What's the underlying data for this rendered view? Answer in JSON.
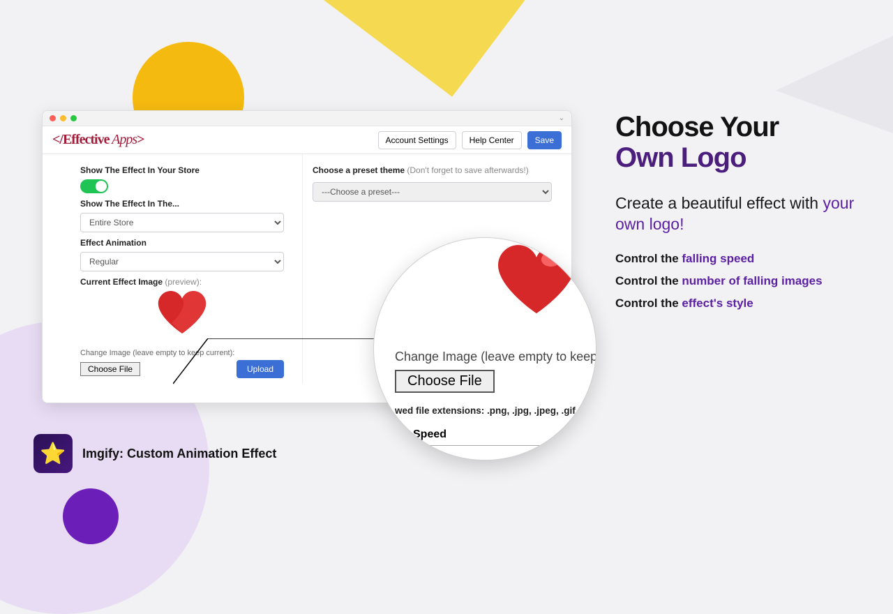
{
  "toolbar": {
    "account": "Account Settings",
    "help": "Help Center",
    "save": "Save"
  },
  "left": {
    "show_store_label": "Show The Effect In Your Store",
    "show_in_label": "Show The Effect In The...",
    "show_in_value": "Entire Store",
    "anim_label": "Effect Animation",
    "anim_value": "Regular",
    "current_label": "Current Effect Image",
    "current_sub": "(preview):",
    "change_label": "Change Image (leave empty to keep current):",
    "choose_file": "Choose File",
    "upload": "Upload"
  },
  "right": {
    "preset_label": "Choose a preset theme",
    "preset_sub": "(Don't forget to save afterwards!)",
    "preset_value": "---Choose a preset---"
  },
  "zoom": {
    "change_label": "Change Image (leave empty to keep current)",
    "choose_file": "Choose File",
    "ext": "wed file extensions: .png, .jpg, .jpeg, .gif, .bmp;",
    "speed": "Speed"
  },
  "mkt": {
    "h1a": "Choose Your",
    "h1b": "Own Logo",
    "lead_a": "Create a beautiful effect with ",
    "lead_b": "your own logo!",
    "b1a": "Control the ",
    "b1b": "falling speed",
    "b2a": "Control the ",
    "b2b": "number of falling images",
    "b3a": "Control the ",
    "b3b": "effect's style"
  },
  "app": {
    "name": "Imgify: Custom Animation Effect"
  }
}
